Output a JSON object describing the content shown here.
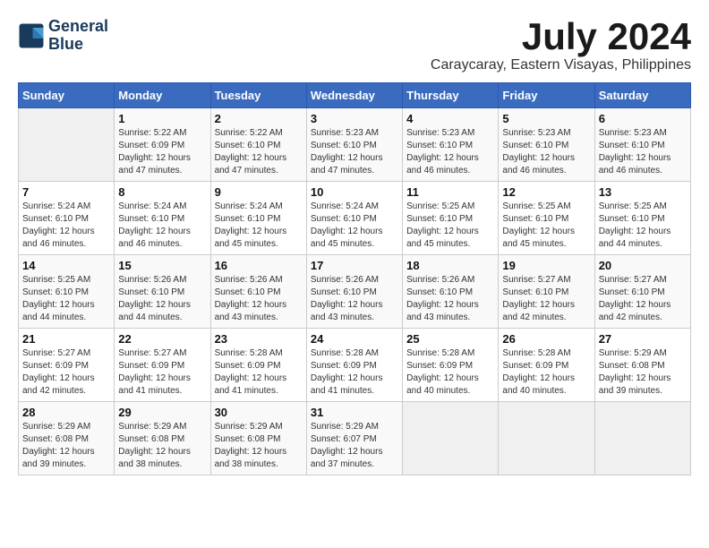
{
  "logo": {
    "line1": "General",
    "line2": "Blue"
  },
  "title": "July 2024",
  "location": "Caraycaray, Eastern Visayas, Philippines",
  "headers": [
    "Sunday",
    "Monday",
    "Tuesday",
    "Wednesday",
    "Thursday",
    "Friday",
    "Saturday"
  ],
  "weeks": [
    [
      {
        "day": "",
        "info": ""
      },
      {
        "day": "1",
        "info": "Sunrise: 5:22 AM\nSunset: 6:09 PM\nDaylight: 12 hours\nand 47 minutes."
      },
      {
        "day": "2",
        "info": "Sunrise: 5:22 AM\nSunset: 6:10 PM\nDaylight: 12 hours\nand 47 minutes."
      },
      {
        "day": "3",
        "info": "Sunrise: 5:23 AM\nSunset: 6:10 PM\nDaylight: 12 hours\nand 47 minutes."
      },
      {
        "day": "4",
        "info": "Sunrise: 5:23 AM\nSunset: 6:10 PM\nDaylight: 12 hours\nand 46 minutes."
      },
      {
        "day": "5",
        "info": "Sunrise: 5:23 AM\nSunset: 6:10 PM\nDaylight: 12 hours\nand 46 minutes."
      },
      {
        "day": "6",
        "info": "Sunrise: 5:23 AM\nSunset: 6:10 PM\nDaylight: 12 hours\nand 46 minutes."
      }
    ],
    [
      {
        "day": "7",
        "info": "Sunrise: 5:24 AM\nSunset: 6:10 PM\nDaylight: 12 hours\nand 46 minutes."
      },
      {
        "day": "8",
        "info": "Sunrise: 5:24 AM\nSunset: 6:10 PM\nDaylight: 12 hours\nand 46 minutes."
      },
      {
        "day": "9",
        "info": "Sunrise: 5:24 AM\nSunset: 6:10 PM\nDaylight: 12 hours\nand 45 minutes."
      },
      {
        "day": "10",
        "info": "Sunrise: 5:24 AM\nSunset: 6:10 PM\nDaylight: 12 hours\nand 45 minutes."
      },
      {
        "day": "11",
        "info": "Sunrise: 5:25 AM\nSunset: 6:10 PM\nDaylight: 12 hours\nand 45 minutes."
      },
      {
        "day": "12",
        "info": "Sunrise: 5:25 AM\nSunset: 6:10 PM\nDaylight: 12 hours\nand 45 minutes."
      },
      {
        "day": "13",
        "info": "Sunrise: 5:25 AM\nSunset: 6:10 PM\nDaylight: 12 hours\nand 44 minutes."
      }
    ],
    [
      {
        "day": "14",
        "info": "Sunrise: 5:25 AM\nSunset: 6:10 PM\nDaylight: 12 hours\nand 44 minutes."
      },
      {
        "day": "15",
        "info": "Sunrise: 5:26 AM\nSunset: 6:10 PM\nDaylight: 12 hours\nand 44 minutes."
      },
      {
        "day": "16",
        "info": "Sunrise: 5:26 AM\nSunset: 6:10 PM\nDaylight: 12 hours\nand 43 minutes."
      },
      {
        "day": "17",
        "info": "Sunrise: 5:26 AM\nSunset: 6:10 PM\nDaylight: 12 hours\nand 43 minutes."
      },
      {
        "day": "18",
        "info": "Sunrise: 5:26 AM\nSunset: 6:10 PM\nDaylight: 12 hours\nand 43 minutes."
      },
      {
        "day": "19",
        "info": "Sunrise: 5:27 AM\nSunset: 6:10 PM\nDaylight: 12 hours\nand 42 minutes."
      },
      {
        "day": "20",
        "info": "Sunrise: 5:27 AM\nSunset: 6:10 PM\nDaylight: 12 hours\nand 42 minutes."
      }
    ],
    [
      {
        "day": "21",
        "info": "Sunrise: 5:27 AM\nSunset: 6:09 PM\nDaylight: 12 hours\nand 42 minutes."
      },
      {
        "day": "22",
        "info": "Sunrise: 5:27 AM\nSunset: 6:09 PM\nDaylight: 12 hours\nand 41 minutes."
      },
      {
        "day": "23",
        "info": "Sunrise: 5:28 AM\nSunset: 6:09 PM\nDaylight: 12 hours\nand 41 minutes."
      },
      {
        "day": "24",
        "info": "Sunrise: 5:28 AM\nSunset: 6:09 PM\nDaylight: 12 hours\nand 41 minutes."
      },
      {
        "day": "25",
        "info": "Sunrise: 5:28 AM\nSunset: 6:09 PM\nDaylight: 12 hours\nand 40 minutes."
      },
      {
        "day": "26",
        "info": "Sunrise: 5:28 AM\nSunset: 6:09 PM\nDaylight: 12 hours\nand 40 minutes."
      },
      {
        "day": "27",
        "info": "Sunrise: 5:29 AM\nSunset: 6:08 PM\nDaylight: 12 hours\nand 39 minutes."
      }
    ],
    [
      {
        "day": "28",
        "info": "Sunrise: 5:29 AM\nSunset: 6:08 PM\nDaylight: 12 hours\nand 39 minutes."
      },
      {
        "day": "29",
        "info": "Sunrise: 5:29 AM\nSunset: 6:08 PM\nDaylight: 12 hours\nand 38 minutes."
      },
      {
        "day": "30",
        "info": "Sunrise: 5:29 AM\nSunset: 6:08 PM\nDaylight: 12 hours\nand 38 minutes."
      },
      {
        "day": "31",
        "info": "Sunrise: 5:29 AM\nSunset: 6:07 PM\nDaylight: 12 hours\nand 37 minutes."
      },
      {
        "day": "",
        "info": ""
      },
      {
        "day": "",
        "info": ""
      },
      {
        "day": "",
        "info": ""
      }
    ]
  ]
}
